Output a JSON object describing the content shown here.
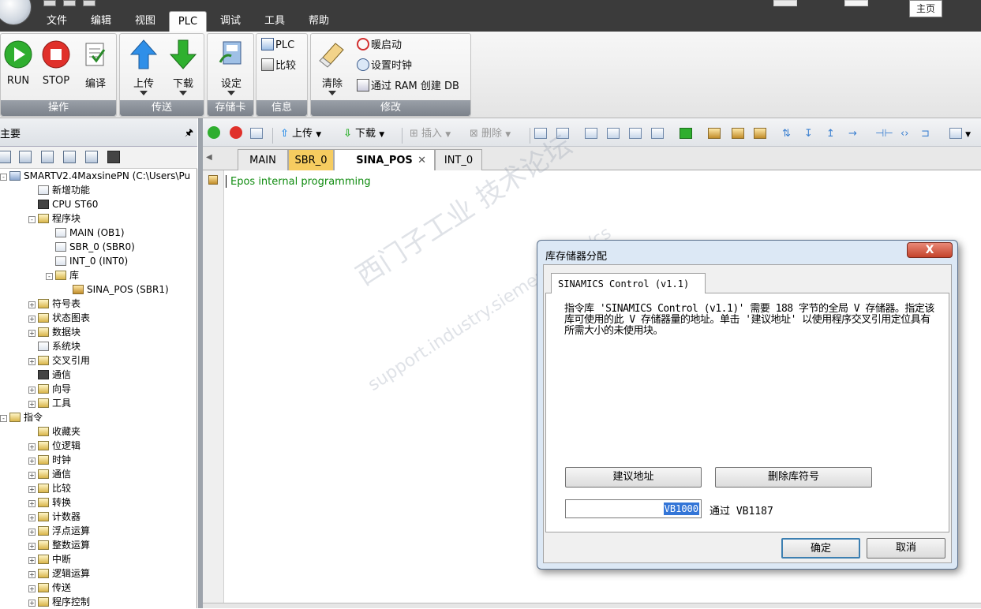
{
  "app": {
    "menu": [
      "文件",
      "编辑",
      "视图",
      "PLC",
      "调试",
      "工具",
      "帮助"
    ],
    "active_menu": "PLC",
    "home_tooltip": "主页"
  },
  "ribbon": {
    "groups": [
      {
        "label": "操作",
        "buttons": [
          "RUN",
          "STOP",
          "编译"
        ]
      },
      {
        "label": "传送",
        "buttons": [
          "上传",
          "下载"
        ]
      },
      {
        "label": "存储卡",
        "buttons": [
          "设定"
        ]
      },
      {
        "label": "信息",
        "buttons": [
          "PLC",
          "比较"
        ]
      },
      {
        "label": "修改",
        "buttons": [
          "清除",
          "暖启动",
          "设置时钟",
          "通过 RAM 创建 DB"
        ]
      }
    ]
  },
  "left_panel": {
    "title": "主要",
    "pin": "ᵖ",
    "tree": [
      {
        "label": "SMARTV2.4MaxsinePN (C:\\Users\\Pu",
        "level": 0,
        "expand": "-",
        "icon": "blue"
      },
      {
        "label": "新增功能",
        "level": 1,
        "expand": "",
        "icon": "doc"
      },
      {
        "label": "CPU ST60",
        "level": 1,
        "expand": "",
        "icon": "dark"
      },
      {
        "label": "程序块",
        "level": 1,
        "expand": "-",
        "icon": "folder"
      },
      {
        "label": "MAIN (OB1)",
        "level": 2,
        "expand": "",
        "icon": "doc"
      },
      {
        "label": "SBR_0 (SBR0)",
        "level": 2,
        "expand": "",
        "icon": "doc"
      },
      {
        "label": "INT_0 (INT0)",
        "level": 2,
        "expand": "",
        "icon": "doc"
      },
      {
        "label": "库",
        "level": 2,
        "expand": "-",
        "icon": "folder"
      },
      {
        "label": "SINA_POS (SBR1)",
        "level": 3,
        "expand": "",
        "icon": "lock"
      },
      {
        "label": "符号表",
        "level": 1,
        "expand": "+",
        "icon": "folder"
      },
      {
        "label": "状态图表",
        "level": 1,
        "expand": "+",
        "icon": "folder"
      },
      {
        "label": "数据块",
        "level": 1,
        "expand": "+",
        "icon": "folder"
      },
      {
        "label": "系统块",
        "level": 1,
        "expand": "",
        "icon": "doc"
      },
      {
        "label": "交叉引用",
        "level": 1,
        "expand": "+",
        "icon": "folder"
      },
      {
        "label": "通信",
        "level": 1,
        "expand": "",
        "icon": "dark"
      },
      {
        "label": "向导",
        "level": 1,
        "expand": "+",
        "icon": "folder"
      },
      {
        "label": "工具",
        "level": 1,
        "expand": "+",
        "icon": "folder"
      },
      {
        "label": "指令",
        "level": 0,
        "expand": "-",
        "icon": "folder"
      },
      {
        "label": "收藏夹",
        "level": 1,
        "expand": "",
        "icon": "folder"
      },
      {
        "label": "位逻辑",
        "level": 1,
        "expand": "+",
        "icon": "folder"
      },
      {
        "label": "时钟",
        "level": 1,
        "expand": "+",
        "icon": "folder"
      },
      {
        "label": "通信",
        "level": 1,
        "expand": "+",
        "icon": "folder"
      },
      {
        "label": "比较",
        "level": 1,
        "expand": "+",
        "icon": "folder"
      },
      {
        "label": "转换",
        "level": 1,
        "expand": "+",
        "icon": "folder"
      },
      {
        "label": "计数器",
        "level": 1,
        "expand": "+",
        "icon": "folder"
      },
      {
        "label": "浮点运算",
        "level": 1,
        "expand": "+",
        "icon": "folder"
      },
      {
        "label": "整数运算",
        "level": 1,
        "expand": "+",
        "icon": "folder"
      },
      {
        "label": "中断",
        "level": 1,
        "expand": "+",
        "icon": "folder"
      },
      {
        "label": "逻辑运算",
        "level": 1,
        "expand": "+",
        "icon": "folder"
      },
      {
        "label": "传送",
        "level": 1,
        "expand": "+",
        "icon": "folder"
      },
      {
        "label": "程序控制",
        "level": 1,
        "expand": "+",
        "icon": "folder"
      }
    ]
  },
  "editor_toolbar": {
    "upload": "上传",
    "download": "下载",
    "insert": "插入",
    "delete": "删除"
  },
  "editor_tabs": [
    "MAIN",
    "SBR_0",
    "SINA_POS",
    "INT_0"
  ],
  "active_tab": "SINA_POS",
  "editor": {
    "comment": "Epos internal programming"
  },
  "watermark": {
    "line1": "西门子工业 技术论坛",
    "line2": "support.industry.siemens.com/cs"
  },
  "dialog": {
    "title": "库存储器分配",
    "close": "X",
    "tab": "SINAMICS Control (v1.1)",
    "message": "指令库 'SINAMICS Control (v1.1)' 需要 188 字节的全局 V 存储器。指定该库可使用的此 V 存储器量的地址。单击 '建议地址' 以使用程序交叉引用定位具有所需大小的未使用块。",
    "suggest_button": "建议地址",
    "delete_button": "删除库符号",
    "address_value": "VB1000",
    "through_text": "通过 VB1187",
    "ok": "确定",
    "cancel": "取消"
  }
}
